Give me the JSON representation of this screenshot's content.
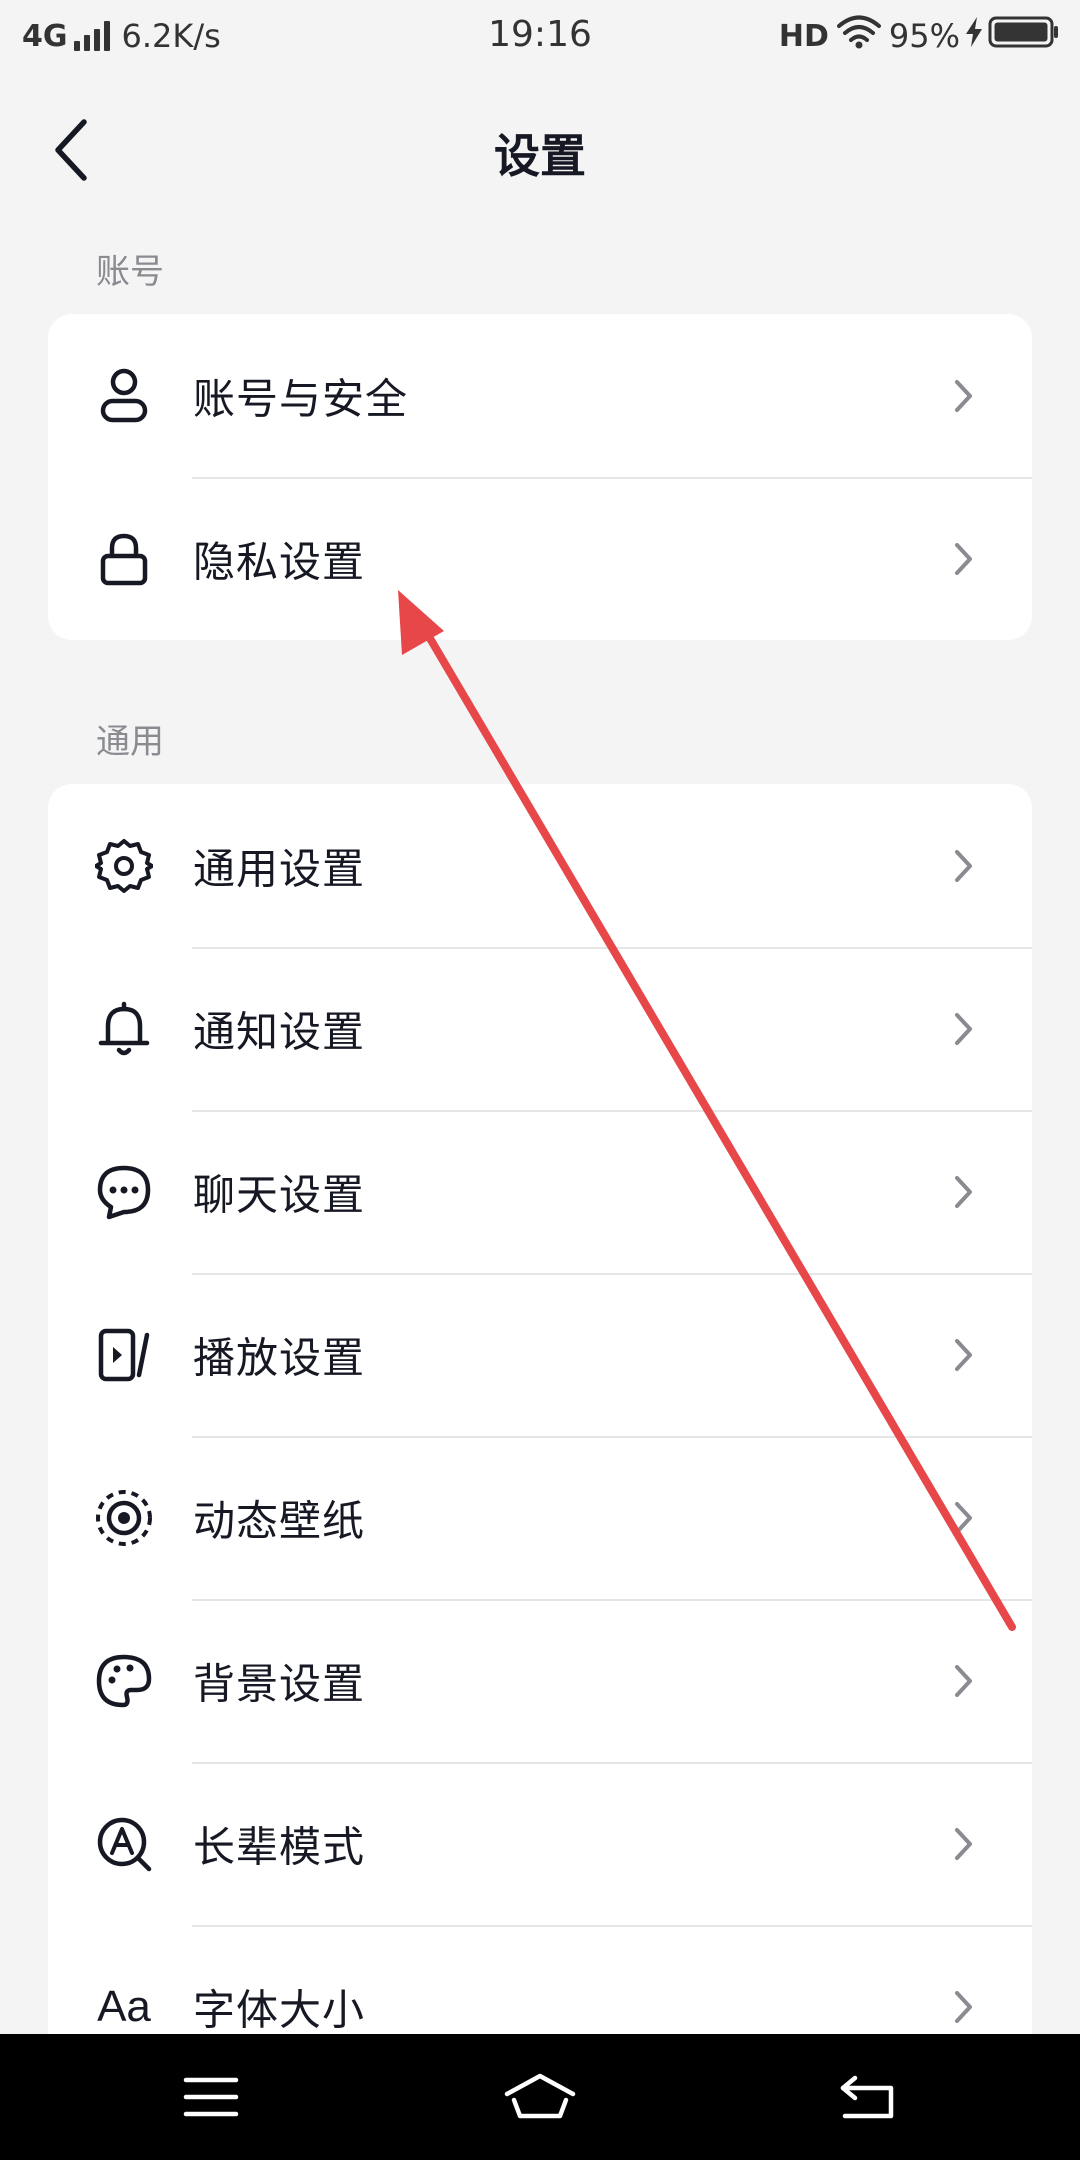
{
  "status_bar": {
    "network": "4G",
    "speed": "6.2K/s",
    "time": "19:16",
    "hd": "HD",
    "battery": "95%"
  },
  "nav": {
    "title": "设置",
    "back_icon": "chevron-left-icon"
  },
  "sections": [
    {
      "label": "账号",
      "items": [
        {
          "label": "账号与安全",
          "icon": "user-icon"
        },
        {
          "label": "隐私设置",
          "icon": "lock-icon"
        }
      ]
    },
    {
      "label": "通用",
      "items": [
        {
          "label": "通用设置",
          "icon": "gear-icon"
        },
        {
          "label": "通知设置",
          "icon": "bell-icon"
        },
        {
          "label": "聊天设置",
          "icon": "chat-bubble-icon"
        },
        {
          "label": "播放设置",
          "icon": "play-screen-icon"
        },
        {
          "label": "动态壁纸",
          "icon": "live-wallpaper-icon"
        },
        {
          "label": "背景设置",
          "icon": "palette-icon"
        },
        {
          "label": "长辈模式",
          "icon": "elder-mode-icon"
        },
        {
          "label": "字体大小",
          "icon": "font-size-icon",
          "icon_text": "Aa"
        }
      ]
    }
  ],
  "colors": {
    "background": "#f4f4f4",
    "card": "#ffffff",
    "text": "#161823",
    "section_label": "#8a8b91",
    "chevron": "#8a8b91",
    "annotation_arrow": "#e8474a",
    "system_bar": "#000000"
  },
  "system_nav": {
    "menu_icon": "menu-icon",
    "home_icon": "home-icon",
    "back_icon": "return-icon"
  }
}
